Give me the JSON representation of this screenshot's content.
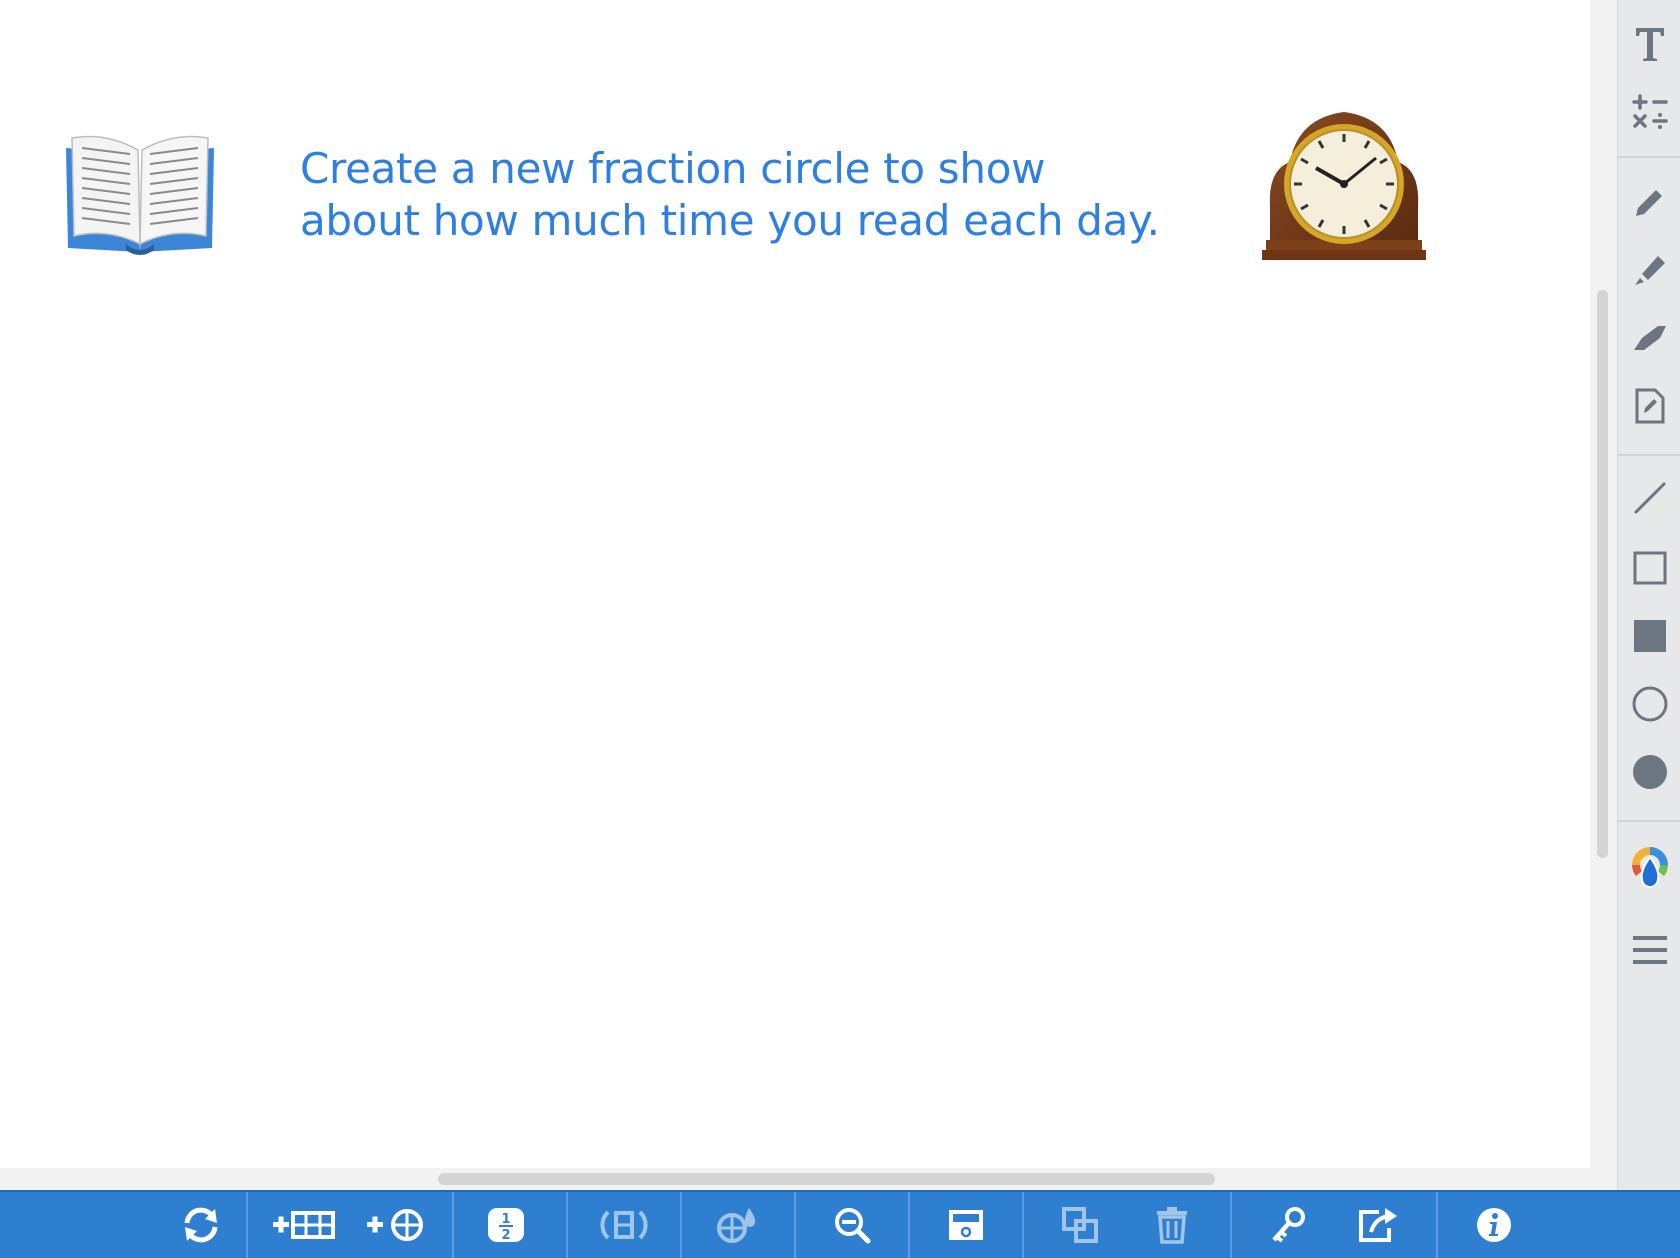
{
  "prompt": {
    "line1": "Create a new fraction circle to show",
    "line2": "about how much time you read each day."
  },
  "icons": {
    "book": "open-book-emoji",
    "clock": "mantelpiece-clock-emoji"
  },
  "sidebar": {
    "tools": [
      {
        "name": "text-tool",
        "icon": "text-T-icon"
      },
      {
        "name": "math-symbols-tool",
        "icon": "plus-minus-times-divide-icon"
      },
      {
        "name": "pen-tool",
        "icon": "pencil-icon"
      },
      {
        "name": "highlighter-tool",
        "icon": "marker-icon"
      },
      {
        "name": "eraser-tool",
        "icon": "eraser-icon"
      },
      {
        "name": "edit-note-tool",
        "icon": "note-pencil-icon"
      },
      {
        "name": "line-tool",
        "icon": "line-icon"
      },
      {
        "name": "rectangle-outline-tool",
        "icon": "square-outline-icon"
      },
      {
        "name": "rectangle-filled-tool",
        "icon": "square-filled-icon"
      },
      {
        "name": "circle-outline-tool",
        "icon": "circle-outline-icon"
      },
      {
        "name": "circle-filled-tool",
        "icon": "circle-filled-icon"
      },
      {
        "name": "color-picker-tool",
        "icon": "color-drop-icon"
      },
      {
        "name": "menu",
        "icon": "hamburger-icon"
      }
    ]
  },
  "toolbar": {
    "buttons": [
      {
        "name": "refresh",
        "icon": "refresh-icon"
      },
      {
        "name": "add-fraction-bar",
        "icon": "add-bar-icon"
      },
      {
        "name": "add-fraction-circle",
        "icon": "add-circle-icon"
      },
      {
        "name": "label-fraction",
        "icon": "one-half-icon"
      },
      {
        "name": "rotate",
        "icon": "rotate-bar-icon"
      },
      {
        "name": "fill-color",
        "icon": "paint-circle-icon"
      },
      {
        "name": "zoom-out",
        "icon": "zoom-out-icon"
      },
      {
        "name": "hide-show",
        "icon": "eye-box-icon"
      },
      {
        "name": "duplicate",
        "icon": "duplicate-icon"
      },
      {
        "name": "delete",
        "icon": "trash-icon"
      },
      {
        "name": "key",
        "icon": "key-icon"
      },
      {
        "name": "share",
        "icon": "share-icon"
      },
      {
        "name": "info",
        "icon": "info-icon"
      }
    ]
  },
  "colors": {
    "prompt_text": "#2f7fe0",
    "toolbar_bg": "#2f7fd0",
    "sidebar_bg": "#e7e8ea",
    "sidebar_icon": "#6b7680"
  }
}
